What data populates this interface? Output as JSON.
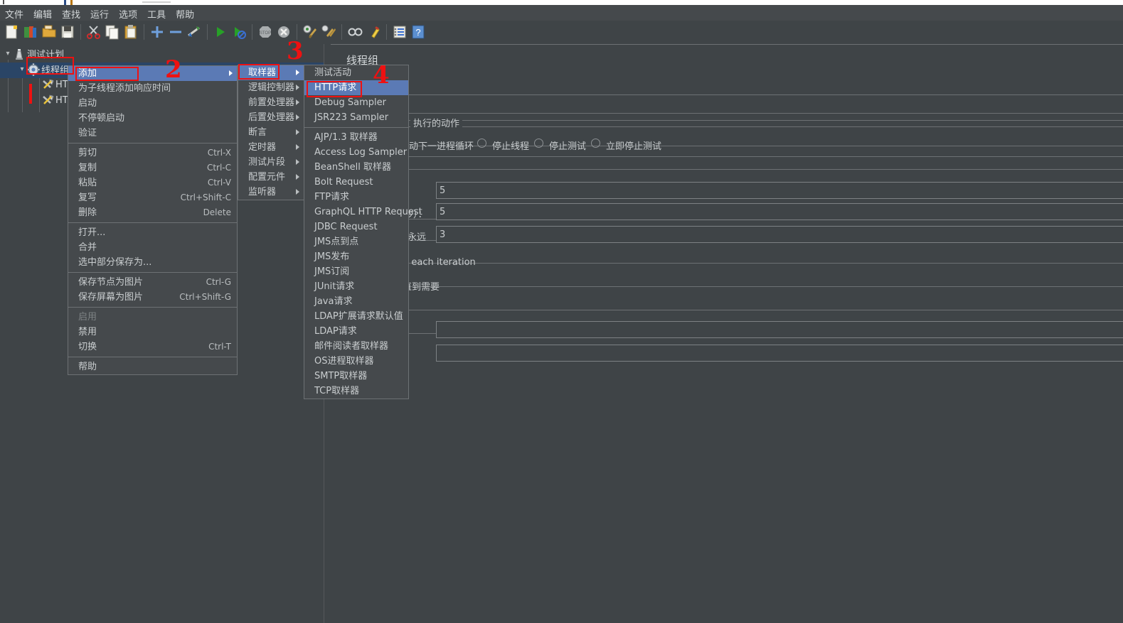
{
  "app": {
    "menubar": [
      "文件",
      "编辑",
      "查找",
      "运行",
      "选项",
      "工具",
      "帮助"
    ],
    "toolbar_icons": [
      "new-file-icon",
      "open-templates-icon",
      "open-folder-icon",
      "save-icon",
      "cut-icon",
      "copy-icon",
      "paste-icon",
      "expand-all-icon",
      "collapse-all-icon",
      "toggle-icon",
      "start-icon",
      "start-no-pauses-icon",
      "stop-icon",
      "shutdown-icon",
      "clear-icon",
      "clear-all-icon",
      "search-icon",
      "search-reset-icon",
      "function-helper-icon",
      "help-icon"
    ]
  },
  "tree": {
    "items": [
      {
        "label": "测试计划",
        "icon": "test-plan-icon",
        "indent": 0,
        "expanded": true
      },
      {
        "label": "线程组",
        "icon": "thread-group-icon",
        "indent": 1,
        "expanded": true,
        "selected": true
      },
      {
        "label": "HT",
        "icon": "http-request-icon",
        "indent": 2,
        "expanded": false
      },
      {
        "label": "HT",
        "icon": "http-request-icon",
        "indent": 2,
        "expanded": false
      }
    ]
  },
  "right_panel": {
    "title": "线程组",
    "action_group_caption": "执行的动作",
    "action_options": [
      "动下一进程循环",
      "停止线程",
      "停止测试",
      "立即停止测试"
    ],
    "fields": [
      {
        "label": "",
        "value": "5"
      },
      {
        "label": "沙）：",
        "value": "5"
      },
      {
        "label": "永远",
        "value": "3"
      },
      {
        "label": "",
        "value": ""
      },
      {
        "label": "",
        "value": ""
      }
    ],
    "notes": [
      "n each iteration",
      "直到需要"
    ]
  },
  "context_menu": {
    "items": [
      {
        "label": "添加",
        "accel": "",
        "submenu": true,
        "highlight": true
      },
      {
        "label": "为子线程添加响应时间",
        "accel": "",
        "submenu": false
      },
      {
        "label": "启动",
        "accel": "",
        "submenu": false
      },
      {
        "label": "不停顿启动",
        "accel": "",
        "submenu": false
      },
      {
        "label": "验证",
        "accel": "",
        "submenu": false
      },
      {
        "separator": true
      },
      {
        "label": "剪切",
        "accel": "Ctrl-X",
        "submenu": false
      },
      {
        "label": "复制",
        "accel": "Ctrl-C",
        "submenu": false
      },
      {
        "label": "粘贴",
        "accel": "Ctrl-V",
        "submenu": false
      },
      {
        "label": "复写",
        "accel": "Ctrl+Shift-C",
        "submenu": false
      },
      {
        "label": "删除",
        "accel": "Delete",
        "submenu": false
      },
      {
        "separator": true
      },
      {
        "label": "打开...",
        "accel": "",
        "submenu": false
      },
      {
        "label": "合并",
        "accel": "",
        "submenu": false
      },
      {
        "label": "选中部分保存为...",
        "accel": "",
        "submenu": false
      },
      {
        "separator": true
      },
      {
        "label": "保存节点为图片",
        "accel": "Ctrl-G",
        "submenu": false
      },
      {
        "label": "保存屏幕为图片",
        "accel": "Ctrl+Shift-G",
        "submenu": false
      },
      {
        "separator": true
      },
      {
        "label": "启用",
        "accel": "",
        "submenu": false,
        "disabled": true
      },
      {
        "label": "禁用",
        "accel": "",
        "submenu": false
      },
      {
        "label": "切换",
        "accel": "Ctrl-T",
        "submenu": false
      },
      {
        "separator": true
      },
      {
        "label": "帮助",
        "accel": "",
        "submenu": false
      }
    ]
  },
  "add_submenu": {
    "items": [
      {
        "label": "取样器",
        "submenu": true,
        "highlight": true
      },
      {
        "label": "逻辑控制器",
        "submenu": true
      },
      {
        "label": "前置处理器",
        "submenu": true
      },
      {
        "label": "后置处理器",
        "submenu": true
      },
      {
        "label": "断言",
        "submenu": true
      },
      {
        "label": "定时器",
        "submenu": true
      },
      {
        "label": "测试片段",
        "submenu": true
      },
      {
        "label": "配置元件",
        "submenu": true
      },
      {
        "label": "监听器",
        "submenu": true
      }
    ]
  },
  "sampler_submenu": {
    "items": [
      {
        "label": "测试活动"
      },
      {
        "label": "HTTP请求",
        "highlight": true
      },
      {
        "label": "Debug Sampler"
      },
      {
        "label": "JSR223 Sampler"
      },
      {
        "separator": true
      },
      {
        "label": "AJP/1.3 取样器"
      },
      {
        "label": "Access Log Sampler"
      },
      {
        "label": "BeanShell 取样器"
      },
      {
        "label": "Bolt Request"
      },
      {
        "label": "FTP请求"
      },
      {
        "label": "GraphQL HTTP Request"
      },
      {
        "label": "JDBC Request"
      },
      {
        "label": "JMS点到点"
      },
      {
        "label": "JMS发布"
      },
      {
        "label": "JMS订阅"
      },
      {
        "label": "JUnit请求"
      },
      {
        "label": "Java请求"
      },
      {
        "label": "LDAP扩展请求默认值"
      },
      {
        "label": "LDAP请求"
      },
      {
        "label": "邮件阅读者取样器"
      },
      {
        "label": "OS进程取样器"
      },
      {
        "label": "SMTP取样器"
      },
      {
        "label": "TCP取样器"
      }
    ]
  },
  "annotations": {
    "color": "#ee1111",
    "marks": [
      {
        "text": "1",
        "type": "bar"
      },
      {
        "text": "2",
        "type": "number"
      },
      {
        "text": "3",
        "type": "number"
      },
      {
        "text": "4",
        "type": "number"
      }
    ],
    "boxes": [
      "thread-group-node-box",
      "add-menu-item-box",
      "sampler-submenu-item-box",
      "http-request-item-box"
    ]
  },
  "colors": {
    "window_bg": "#3f4447",
    "menu_bg": "#45494c",
    "highlight": "#5b7ab5",
    "tree_selection": "#2a4566",
    "text": "#c9cdcf",
    "annotation": "#ee1111"
  }
}
